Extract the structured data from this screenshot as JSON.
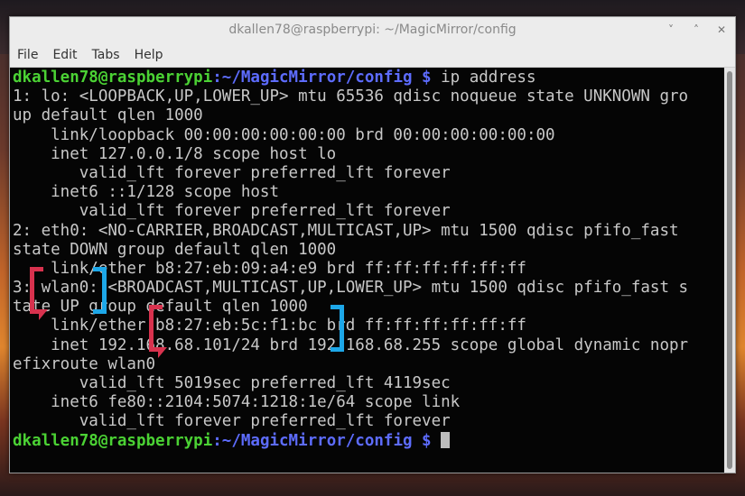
{
  "window": {
    "title": "dkallen78@raspberrypi: ~/MagicMirror/config",
    "controls": [
      "˅",
      "˄",
      "✕"
    ]
  },
  "menu": [
    "File",
    "Edit",
    "Tabs",
    "Help"
  ],
  "terminal": {
    "prompt_user": "dkallen78@raspberrypi",
    "prompt_path": ":~/MagicMirror/config $",
    "command": " ip address",
    "output": [
      "1: lo: <LOOPBACK,UP,LOWER_UP> mtu 65536 qdisc noqueue state UNKNOWN gro",
      "up default qlen 1000",
      "    link/loopback 00:00:00:00:00:00 brd 00:00:00:00:00:00",
      "    inet 127.0.0.1/8 scope host lo",
      "       valid_lft forever preferred_lft forever",
      "    inet6 ::1/128 scope host",
      "       valid_lft forever preferred_lft forever",
      "2: eth0: <NO-CARRIER,BROADCAST,MULTICAST,UP> mtu 1500 qdisc pfifo_fast",
      "state DOWN group default qlen 1000",
      "    link/ether b8:27:eb:09:a4:e9 brd ff:ff:ff:ff:ff:ff",
      "3: wlan0: <BROADCAST,MULTICAST,UP,LOWER_UP> mtu 1500 qdisc pfifo_fast s",
      "tate UP group default qlen 1000",
      "    link/ether b8:27:eb:5c:f1:bc brd ff:ff:ff:ff:ff:ff",
      "    inet 192.168.68.101/24 brd 192.168.68.255 scope global dynamic nopr",
      "efixroute wlan0",
      "       valid_lft 5019sec preferred_lft 4119sec",
      "    inet6 fe80::2104:5074:1218:1e/64 scope link",
      "       valid_lft forever preferred_lft forever"
    ]
  },
  "highlights": {
    "interface": "wlan0",
    "mac": "b8:27:eb:5c:f1:bc"
  },
  "colors": {
    "prompt_user": "#4bd234",
    "prompt_path": "#5d6cff",
    "bracket_red": "#d8324e",
    "bracket_blue": "#1da7e8"
  }
}
